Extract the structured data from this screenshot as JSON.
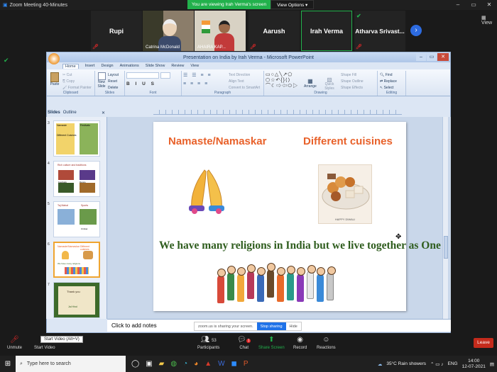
{
  "window": {
    "title": "Zoom Meeting 40-Minutes",
    "controls": [
      "–",
      "▭",
      "✕"
    ]
  },
  "share_banner": {
    "text": "You are viewing Irah Verma's screen",
    "view_options": "View Options ▾"
  },
  "participants": [
    {
      "name": "Rupi",
      "label": ""
    },
    {
      "name": "",
      "label": "Catrina McDonald"
    },
    {
      "name": "",
      "label": "AHAIRA KAP..."
    },
    {
      "name": "Aarush",
      "label": ""
    },
    {
      "name": "Irah Verma",
      "label": ""
    },
    {
      "name": "Atharva  Srivast...",
      "label": ""
    }
  ],
  "view_label": "View",
  "ppt": {
    "title": "Presentation on India by Irah Verma - Microsoft PowerPoint",
    "menus": [
      "Home",
      "Insert",
      "Design",
      "Animations",
      "Slide Show",
      "Review",
      "View"
    ],
    "groups": [
      "Clipboard",
      "Slides",
      "Font",
      "Paragraph",
      "Drawing",
      "Editing"
    ],
    "clipboard": {
      "paste": "Paste",
      "cut": "Cut",
      "copy": "Copy",
      "format": "Format Painter"
    },
    "slides_grp": {
      "new": "New Slide",
      "layout": "Layout",
      "reset": "Reset",
      "delete": "Delete"
    },
    "paragraph": {
      "dir": "Text Direction",
      "align": "Align Text",
      "smart": "Convert to SmartArt"
    },
    "drawing": {
      "arrange": "Arrange",
      "quick": "Quick Styles",
      "fill": "Shape Fill",
      "outline": "Shape Outline",
      "effects": "Shape Effects"
    },
    "editing": {
      "find": "Find",
      "replace": "Replace",
      "select": "Select"
    },
    "panel_tabs": [
      "Slides",
      "Outline"
    ],
    "thumbs": [
      {
        "num": "3",
        "lines": [
          "Namaste",
          "Different Cuisines",
          "Festivals"
        ]
      },
      {
        "num": "4",
        "lines": [
          "Rich culture and traditions",
          "Festivals",
          "Dance"
        ]
      },
      {
        "num": "5",
        "lines": [
          "Taj Mahal",
          "Sports",
          "Cricket"
        ]
      },
      {
        "num": "6",
        "lines": [
          "Namaste/Namaskar",
          "Different cuisines",
          "We have many religions"
        ]
      },
      {
        "num": "7",
        "lines": [
          "Thank you",
          "Jai Hind"
        ]
      }
    ],
    "slide": {
      "left_heading": "Namaste/Namaskar",
      "right_heading": "Different cuisines",
      "sweets_caption": "HAPPY DIWALI",
      "statement": "We have many religions in India but we live together as One"
    },
    "notes_placeholder": "Click to add notes"
  },
  "share_pill": {
    "status": "zoom.us is sharing your screen.",
    "stop": "Stop sharing",
    "hide": "Hide"
  },
  "controls": {
    "unmute": "Unmute",
    "start_video": "Start Video",
    "video_tooltip": "Start Video (Alt+V)",
    "participants": "Participants",
    "participants_count": "53",
    "chat": "Chat",
    "chat_badge": "1",
    "share": "Share Screen",
    "record": "Record",
    "reactions": "Reactions",
    "leave": "Leave"
  },
  "taskbar": {
    "search": "Type here to search",
    "weather": "35°C  Rain showers",
    "lang": "ENG",
    "time": "14:00",
    "date": "12-07-2021"
  },
  "colors": {
    "zoom_green": "#22b14c",
    "accent_blue": "#1f72e8",
    "slide_orange": "#e8612a",
    "slide_green": "#2f5d1e",
    "leave_red": "#c42b1c"
  }
}
